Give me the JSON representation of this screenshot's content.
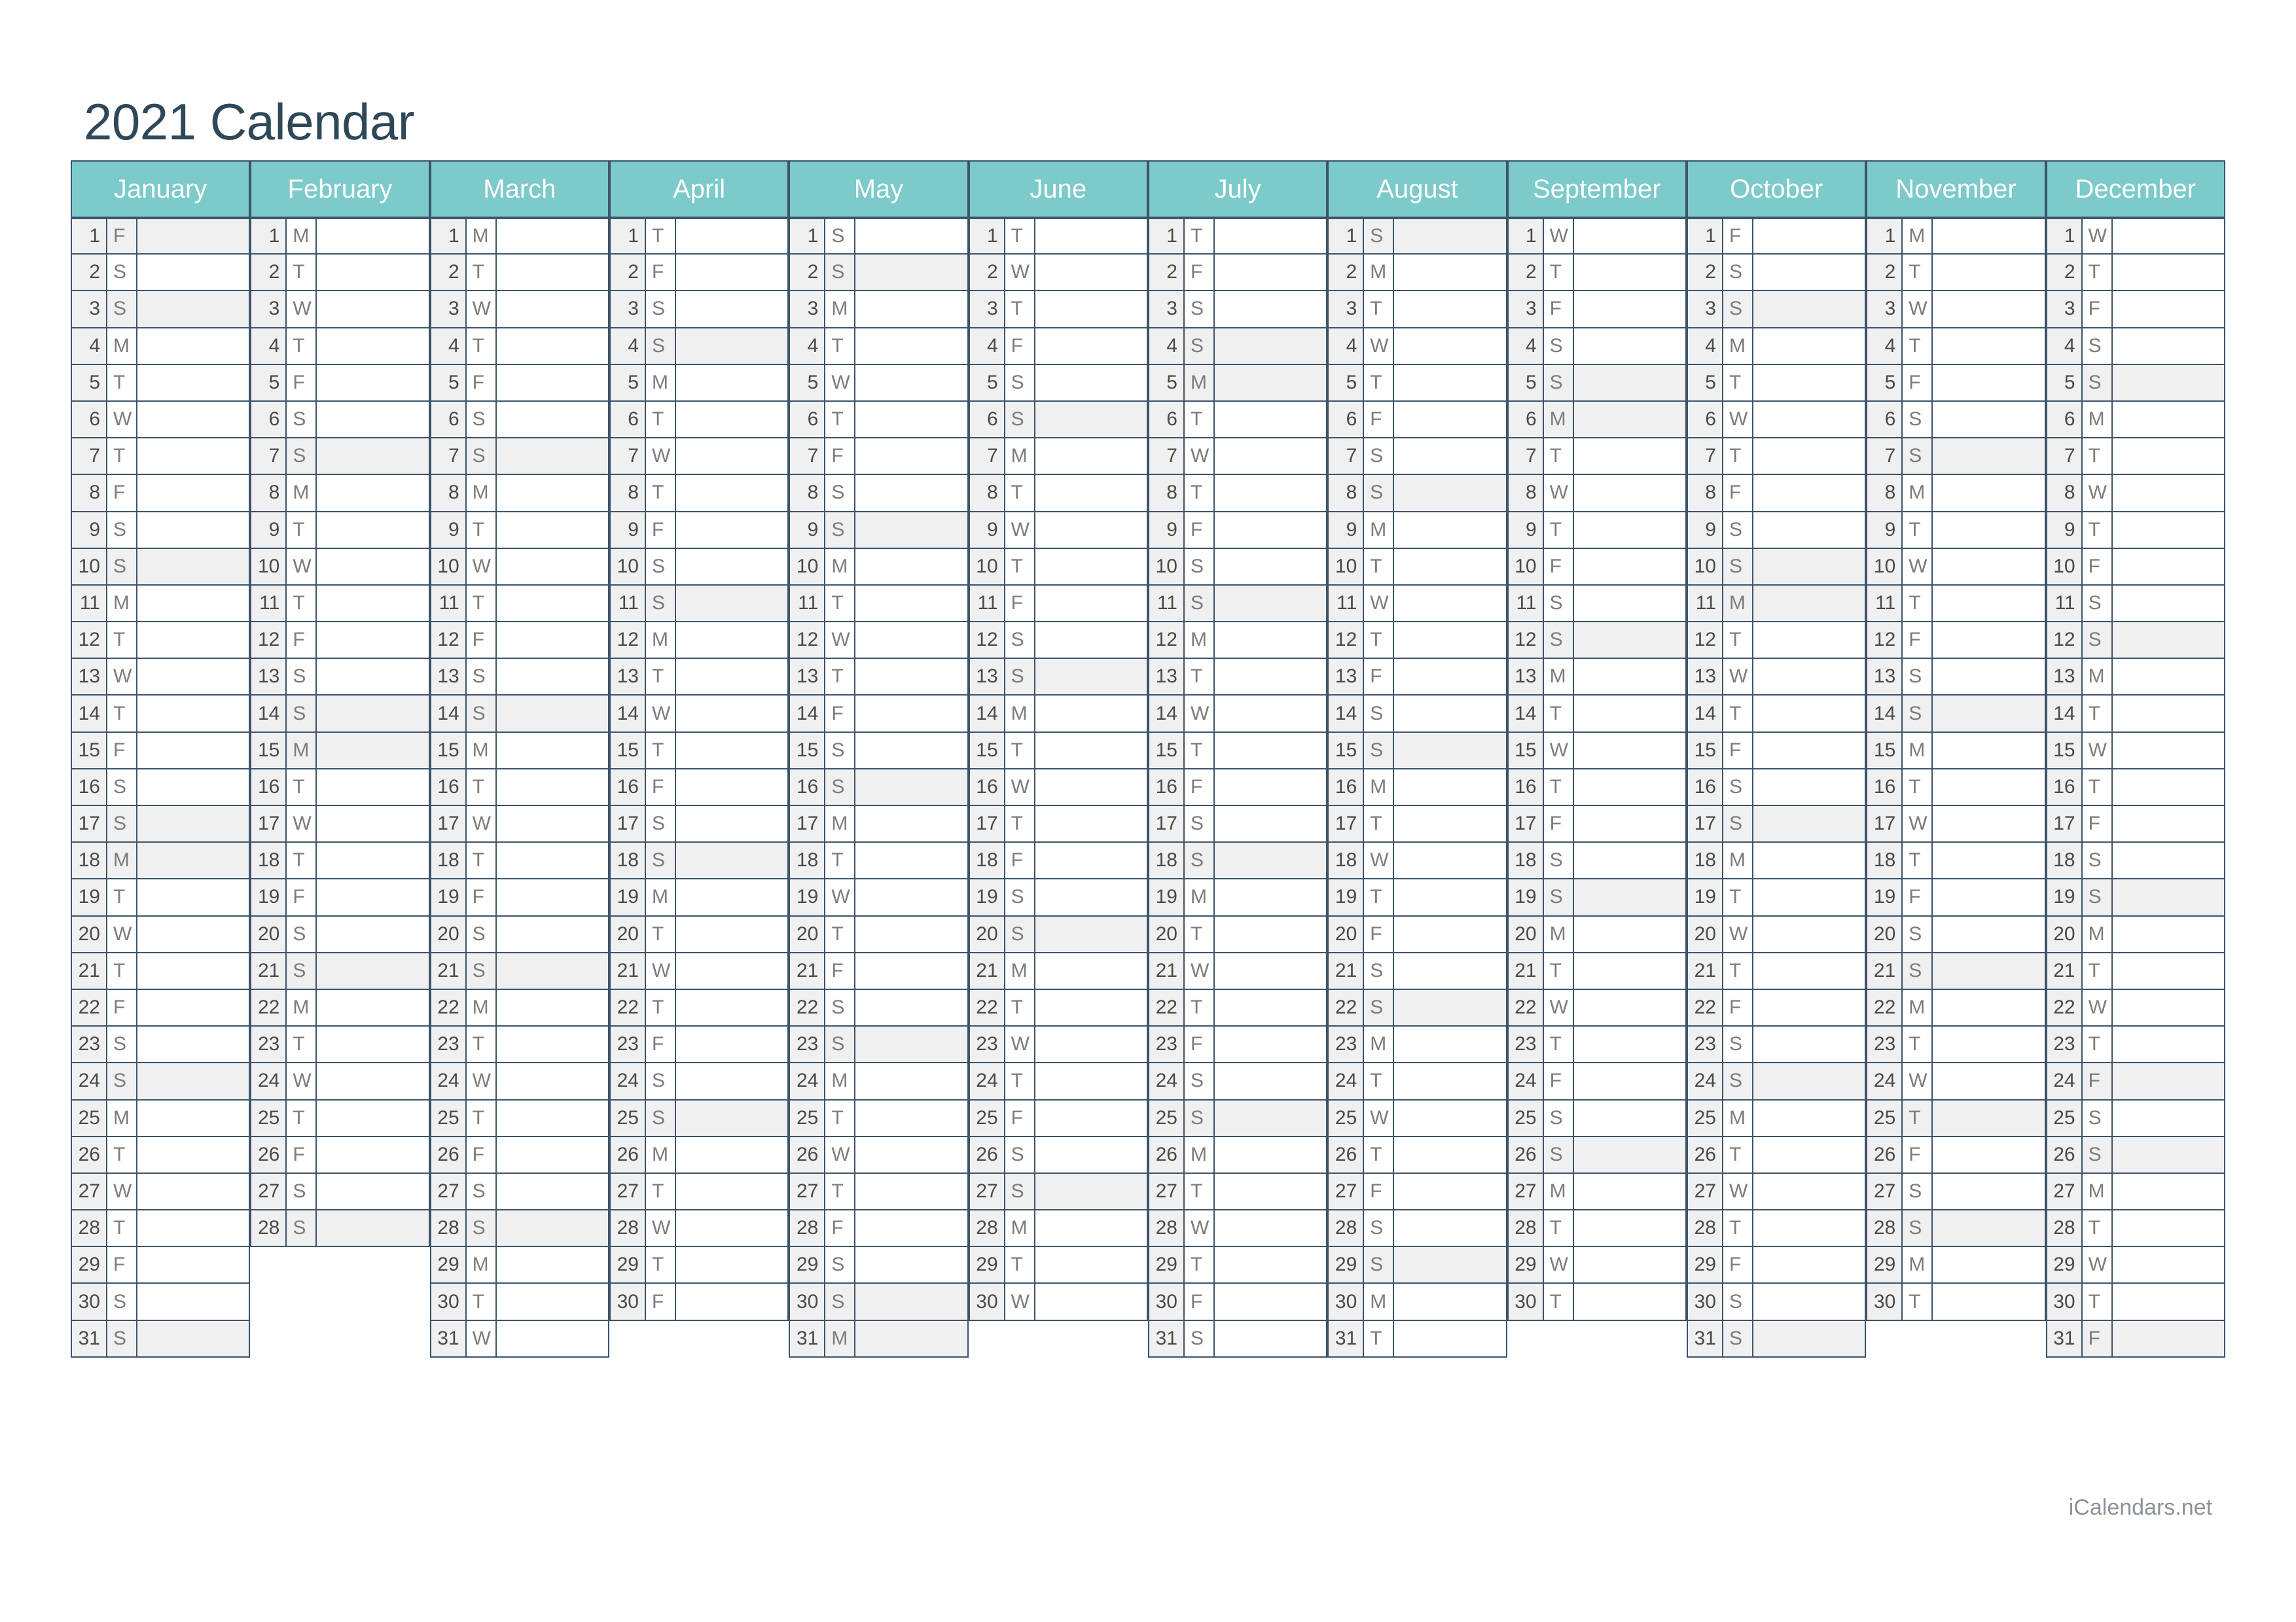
{
  "page": {
    "title": "2021 Calendar",
    "footer": "iCalendars.net",
    "year": 2021
  },
  "colors": {
    "header_background": "#7ccac9",
    "header_text": "#ffffff",
    "border": "#3d546b",
    "shaded_cell": "#f0f0f0",
    "day_number_background": "#f0f0f0",
    "title_text": "#2f4858",
    "day_text": "#4a4a4a",
    "weekday_letter_text": "#7c7c7c",
    "footer_text": "#8c9298"
  },
  "weekday_letters": {
    "Monday": "M",
    "Tuesday": "T",
    "Wednesday": "W",
    "Thursday": "T",
    "Friday": "F",
    "Saturday": "S",
    "Sunday": "S"
  },
  "months": [
    {
      "name": "January",
      "index": 1,
      "days": 31,
      "first_weekday": "Friday",
      "day_letters": [
        "F",
        "S",
        "S",
        "M",
        "T",
        "W",
        "T",
        "F",
        "S",
        "S",
        "M",
        "T",
        "W",
        "T",
        "F",
        "S",
        "S",
        "M",
        "T",
        "W",
        "T",
        "F",
        "S",
        "S",
        "M",
        "T",
        "W",
        "T",
        "F",
        "S",
        "S"
      ],
      "shaded_days": [
        1,
        3,
        10,
        17,
        18,
        24,
        31
      ]
    },
    {
      "name": "February",
      "index": 2,
      "days": 28,
      "first_weekday": "Monday",
      "day_letters": [
        "M",
        "T",
        "W",
        "T",
        "F",
        "S",
        "S",
        "M",
        "T",
        "W",
        "T",
        "F",
        "S",
        "S",
        "M",
        "T",
        "W",
        "T",
        "F",
        "S",
        "S",
        "M",
        "T",
        "W",
        "T",
        "F",
        "S",
        "S"
      ],
      "shaded_days": [
        7,
        14,
        15,
        21,
        28
      ]
    },
    {
      "name": "March",
      "index": 3,
      "days": 31,
      "first_weekday": "Monday",
      "day_letters": [
        "M",
        "T",
        "W",
        "T",
        "F",
        "S",
        "S",
        "M",
        "T",
        "W",
        "T",
        "F",
        "S",
        "S",
        "M",
        "T",
        "W",
        "T",
        "F",
        "S",
        "S",
        "M",
        "T",
        "W",
        "T",
        "F",
        "S",
        "S",
        "M",
        "T",
        "W"
      ],
      "shaded_days": [
        7,
        14,
        21,
        28
      ]
    },
    {
      "name": "April",
      "index": 4,
      "days": 30,
      "first_weekday": "Thursday",
      "day_letters": [
        "T",
        "F",
        "S",
        "S",
        "M",
        "T",
        "W",
        "T",
        "F",
        "S",
        "S",
        "M",
        "T",
        "W",
        "T",
        "F",
        "S",
        "S",
        "M",
        "T",
        "W",
        "T",
        "F",
        "S",
        "S",
        "M",
        "T",
        "W",
        "T",
        "F"
      ],
      "shaded_days": [
        4,
        11,
        18,
        25
      ]
    },
    {
      "name": "May",
      "index": 5,
      "days": 31,
      "first_weekday": "Saturday",
      "day_letters": [
        "S",
        "S",
        "M",
        "T",
        "W",
        "T",
        "F",
        "S",
        "S",
        "M",
        "T",
        "W",
        "T",
        "F",
        "S",
        "S",
        "M",
        "T",
        "W",
        "T",
        "F",
        "S",
        "S",
        "M",
        "T",
        "W",
        "T",
        "F",
        "S",
        "S",
        "M"
      ],
      "shaded_days": [
        2,
        9,
        16,
        23,
        30,
        31
      ]
    },
    {
      "name": "June",
      "index": 6,
      "days": 30,
      "first_weekday": "Tuesday",
      "day_letters": [
        "T",
        "W",
        "T",
        "F",
        "S",
        "S",
        "M",
        "T",
        "W",
        "T",
        "F",
        "S",
        "S",
        "M",
        "T",
        "W",
        "T",
        "F",
        "S",
        "S",
        "M",
        "T",
        "W",
        "T",
        "F",
        "S",
        "S",
        "M",
        "T",
        "W"
      ],
      "shaded_days": [
        6,
        13,
        20,
        27
      ]
    },
    {
      "name": "July",
      "index": 7,
      "days": 31,
      "first_weekday": "Thursday",
      "day_letters": [
        "T",
        "F",
        "S",
        "S",
        "M",
        "T",
        "W",
        "T",
        "F",
        "S",
        "S",
        "M",
        "T",
        "W",
        "T",
        "F",
        "S",
        "S",
        "M",
        "T",
        "W",
        "T",
        "F",
        "S",
        "S",
        "M",
        "T",
        "W",
        "T",
        "F",
        "S"
      ],
      "shaded_days": [
        4,
        5,
        11,
        18,
        25
      ]
    },
    {
      "name": "August",
      "index": 8,
      "days": 31,
      "first_weekday": "Sunday",
      "day_letters": [
        "S",
        "M",
        "T",
        "W",
        "T",
        "F",
        "S",
        "S",
        "M",
        "T",
        "W",
        "T",
        "F",
        "S",
        "S",
        "M",
        "T",
        "W",
        "T",
        "F",
        "S",
        "S",
        "M",
        "T",
        "W",
        "T",
        "F",
        "S",
        "S",
        "M",
        "T"
      ],
      "shaded_days": [
        1,
        8,
        15,
        22,
        29
      ]
    },
    {
      "name": "September",
      "index": 9,
      "days": 30,
      "first_weekday": "Wednesday",
      "day_letters": [
        "W",
        "T",
        "F",
        "S",
        "S",
        "M",
        "T",
        "W",
        "T",
        "F",
        "S",
        "S",
        "M",
        "T",
        "W",
        "T",
        "F",
        "S",
        "S",
        "M",
        "T",
        "W",
        "T",
        "F",
        "S",
        "S",
        "M",
        "T",
        "W",
        "T"
      ],
      "shaded_days": [
        5,
        6,
        12,
        19,
        26
      ]
    },
    {
      "name": "October",
      "index": 10,
      "days": 31,
      "first_weekday": "Friday",
      "day_letters": [
        "F",
        "S",
        "S",
        "M",
        "T",
        "W",
        "T",
        "F",
        "S",
        "S",
        "M",
        "T",
        "W",
        "T",
        "F",
        "S",
        "S",
        "M",
        "T",
        "W",
        "T",
        "F",
        "S",
        "S",
        "M",
        "T",
        "W",
        "T",
        "F",
        "S",
        "S"
      ],
      "shaded_days": [
        3,
        10,
        11,
        17,
        24,
        31
      ]
    },
    {
      "name": "November",
      "index": 11,
      "days": 30,
      "first_weekday": "Monday",
      "day_letters": [
        "M",
        "T",
        "W",
        "T",
        "F",
        "S",
        "S",
        "M",
        "T",
        "W",
        "T",
        "F",
        "S",
        "S",
        "M",
        "T",
        "W",
        "T",
        "F",
        "S",
        "S",
        "M",
        "T",
        "W",
        "T",
        "F",
        "S",
        "S",
        "M",
        "T"
      ],
      "shaded_days": [
        7,
        14,
        21,
        25,
        28
      ]
    },
    {
      "name": "December",
      "index": 12,
      "days": 31,
      "first_weekday": "Wednesday",
      "day_letters": [
        "W",
        "T",
        "F",
        "S",
        "S",
        "M",
        "T",
        "W",
        "T",
        "F",
        "S",
        "S",
        "M",
        "T",
        "W",
        "T",
        "F",
        "S",
        "S",
        "M",
        "T",
        "W",
        "T",
        "F",
        "S",
        "S",
        "M",
        "T",
        "W",
        "T",
        "F"
      ],
      "shaded_days": [
        5,
        12,
        19,
        24,
        26,
        31
      ]
    }
  ]
}
